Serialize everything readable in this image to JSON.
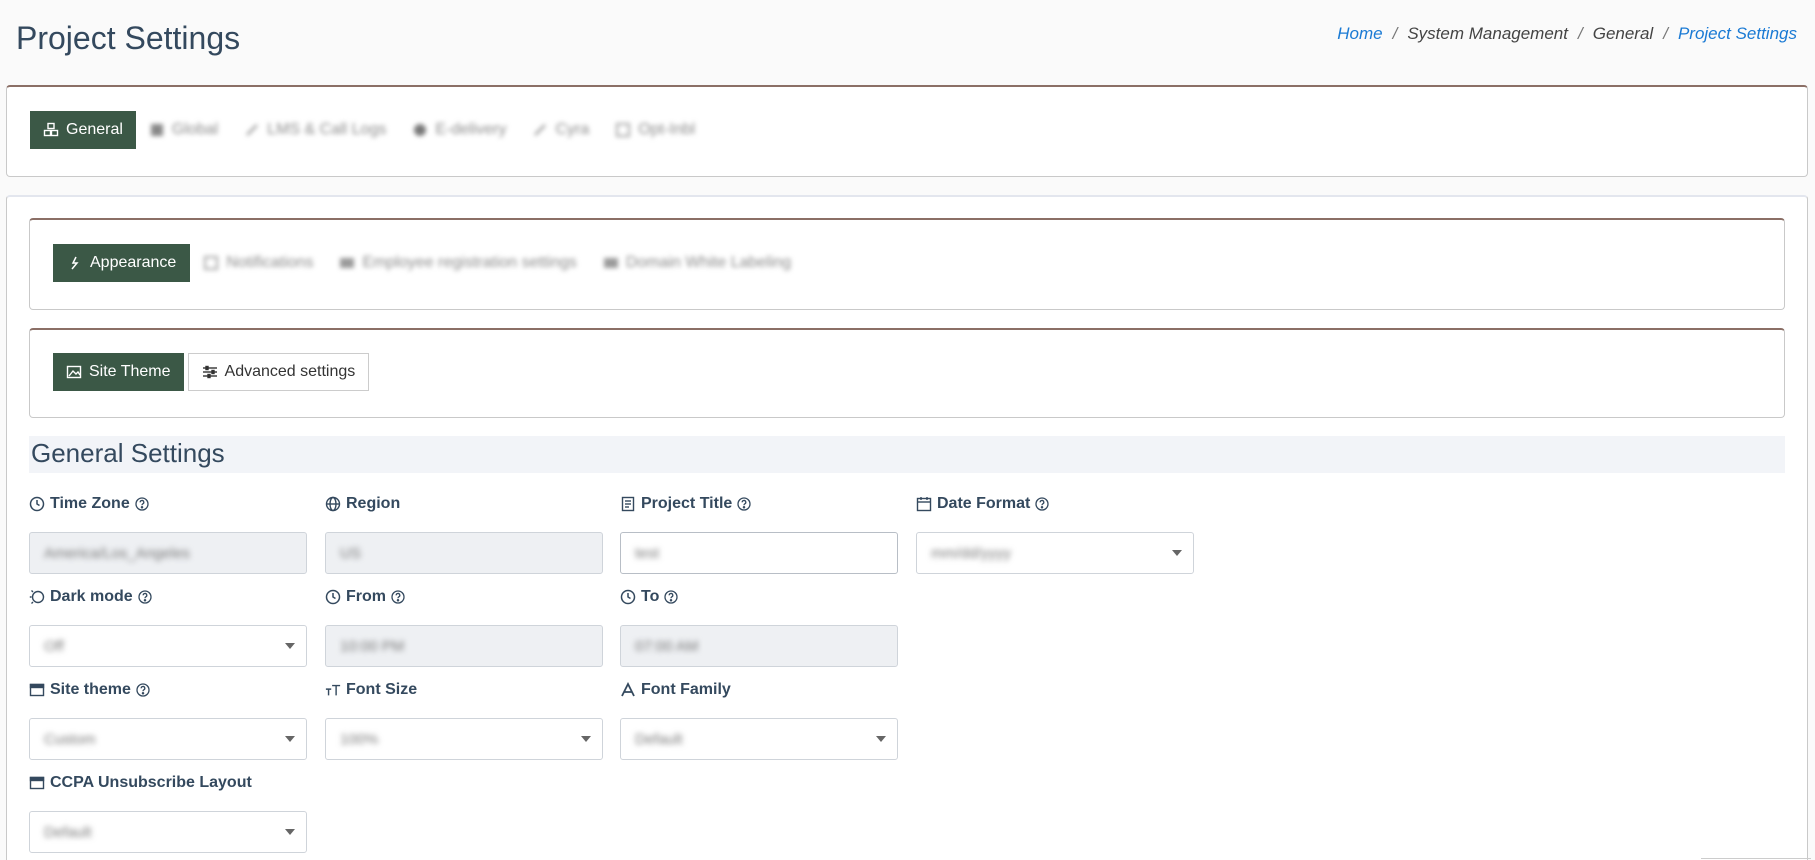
{
  "header": {
    "title": "Project Settings",
    "breadcrumb": [
      "Home",
      "System Management",
      "General",
      "Project Settings"
    ],
    "separator": "/"
  },
  "top_tabs": [
    {
      "label": "General",
      "icon": "cubes-icon",
      "active": true
    },
    {
      "label": "Global",
      "icon": "table-icon",
      "active": false
    },
    {
      "label": "LMS & Call Logs",
      "icon": "pen-icon",
      "active": false
    },
    {
      "label": "E-delivery",
      "icon": "circle-icon",
      "active": false
    },
    {
      "label": "Cyra",
      "icon": "link-icon",
      "active": false
    },
    {
      "label": "Opt-Inbl",
      "icon": "square-icon",
      "active": false
    }
  ],
  "sub_tabs": [
    {
      "label": "Appearance",
      "icon": "brush-icon",
      "active": true
    },
    {
      "label": "Notifications",
      "icon": "bell-icon",
      "active": false
    },
    {
      "label": "Employee registration settings",
      "icon": "id-card-icon",
      "active": false
    },
    {
      "label": "Domain White Labeling",
      "icon": "globe-box-icon",
      "active": false
    }
  ],
  "theme_tabs": [
    {
      "label": "Site Theme",
      "icon": "image-icon",
      "active": true
    },
    {
      "label": "Advanced settings",
      "icon": "sliders-icon",
      "active": false
    }
  ],
  "section": {
    "title": "General Settings"
  },
  "fields": {
    "time_zone": {
      "label": "Time Zone",
      "value": "America/Los_Angeles"
    },
    "region": {
      "label": "Region",
      "value": "US"
    },
    "project_title": {
      "label": "Project Title",
      "value": "test"
    },
    "date_format": {
      "label": "Date Format",
      "value": "mm/dd/yyyy"
    },
    "dark_mode": {
      "label": "Dark mode",
      "value": "Off"
    },
    "from": {
      "label": "From",
      "value": "10:00 PM"
    },
    "to": {
      "label": "To",
      "value": "07:00 AM"
    },
    "site_theme": {
      "label": "Site theme",
      "value": "Custom"
    },
    "font_size": {
      "label": "Font Size",
      "value": "100%"
    },
    "font_family": {
      "label": "Font Family",
      "value": "Default"
    },
    "ccpa_layout": {
      "label": "CCPA Unsubscribe Layout",
      "value": "Default"
    }
  },
  "colors": {
    "active_tab": "#3b5846",
    "link": "#1a7ad4",
    "card_border_accent": "#8b6f66"
  }
}
